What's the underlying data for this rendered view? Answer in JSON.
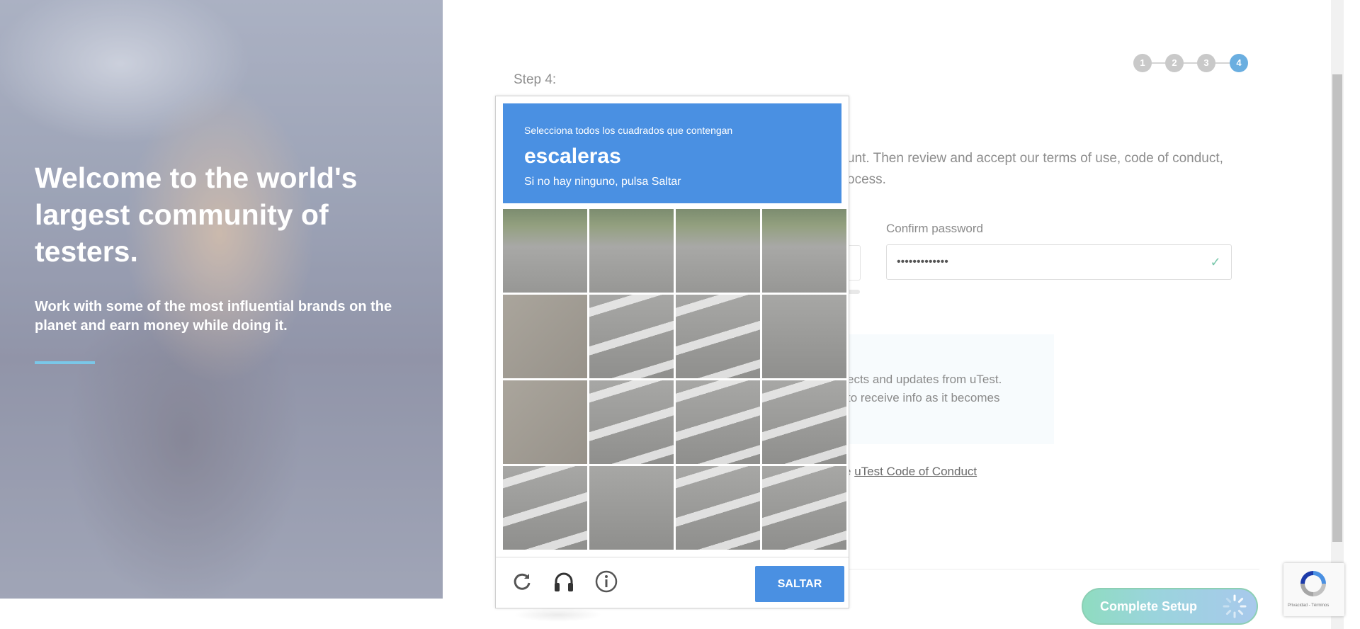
{
  "hero": {
    "title": "Welcome to the world's largest community of testers.",
    "subtitle": "Work with some of the most influential brands on the planet and earn money while doing it."
  },
  "form": {
    "step_label": "Step 4:",
    "steps": [
      "1",
      "2",
      "3",
      "4"
    ],
    "active_step": 4,
    "intro_line1": "unt. Then review and accept our terms of use, code of conduct,",
    "intro_line2": "ocess.",
    "confirm_password_label": "Confirm password",
    "confirm_password_value": "•••••••••••••",
    "info_line1": "ects and updates from uTest.",
    "info_line2": "to receive info as it becomes",
    "conduct_prefix": "e ",
    "conduct_link": "uTest Code of Conduct",
    "complete_button": "Complete Setup"
  },
  "captcha": {
    "instruction": "Selecciona todos los cuadrados que contengan",
    "target_word": "escaleras",
    "skip_note": "Si no hay ninguno, pulsa Saltar",
    "skip_button": "SALTAR",
    "tile_count": 16,
    "icons": [
      "reload-icon",
      "audio-headphones-icon",
      "info-icon"
    ]
  },
  "recaptcha_badge": {
    "terms": "Privacidad - Términos"
  },
  "colors": {
    "captcha_blue": "#4a90e2",
    "step_active": "#6aaee0",
    "success_green": "#79c7ab"
  }
}
